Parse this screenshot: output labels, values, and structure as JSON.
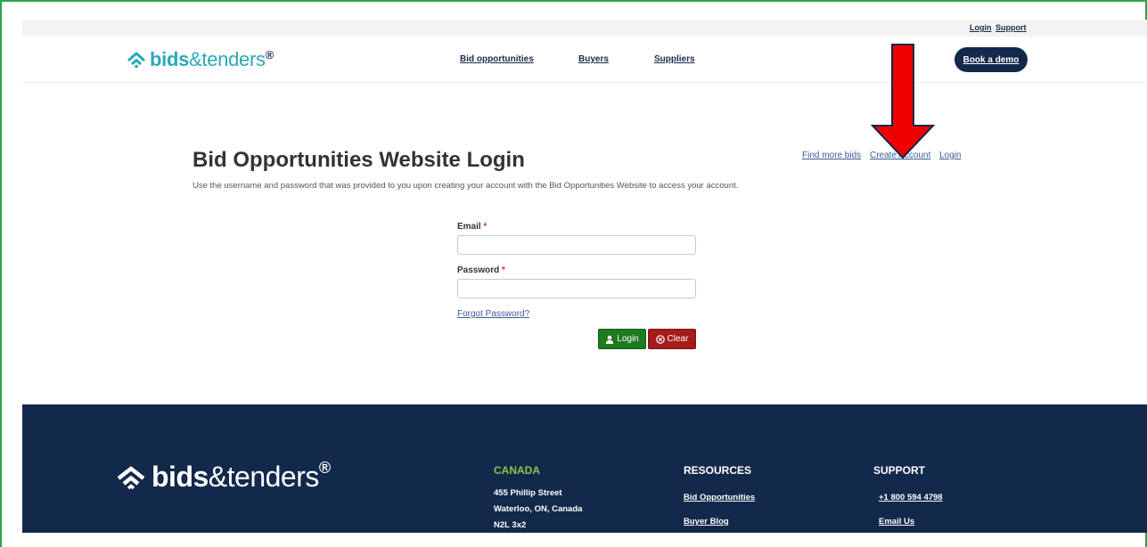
{
  "utility": {
    "login": "Login",
    "support": "Support"
  },
  "nav": {
    "brand_bold": "bids",
    "brand_rest": "&tenders",
    "brand_reg": "®",
    "links": [
      "Bid opportunities",
      "Buyers",
      "Suppliers"
    ],
    "demo_button": "Book a demo"
  },
  "top_links": {
    "find_more": "Find more bids",
    "create_account": "Create Account",
    "login": "Login"
  },
  "main": {
    "title": "Bid Opportunities Website Login",
    "description": "Use the username and password that was provided to you upon creating your account with the Bid Opportunities Website to access your account.",
    "email_label": "Email",
    "password_label": "Password",
    "required_mark": "*",
    "email_value": "",
    "password_value": "",
    "forgot": "Forgot Password?",
    "login_button": "Login",
    "clear_button": "Clear"
  },
  "footer": {
    "brand_bold": "bids",
    "brand_rest": "&tenders",
    "brand_reg": "®",
    "canada_heading": "CANADA",
    "address_line1": "455 Phillip Street",
    "address_line2": "Waterloo, ON, Canada",
    "address_line3": "N2L 3x2",
    "resources_heading": "RESOURCES",
    "resources_links": [
      "Bid Opportunities",
      "Buyer Blog"
    ],
    "support_heading": "SUPPORT",
    "support_phone": "+1 800 594 4798",
    "support_email": "Email Us"
  },
  "colors": {
    "brand_teal": "#2ba8b5",
    "navy": "#13294b",
    "login_green": "#1e7a1e",
    "clear_red": "#a61c1c",
    "annotation_arrow": "#ee0000",
    "frame_green": "#2aa54a"
  }
}
